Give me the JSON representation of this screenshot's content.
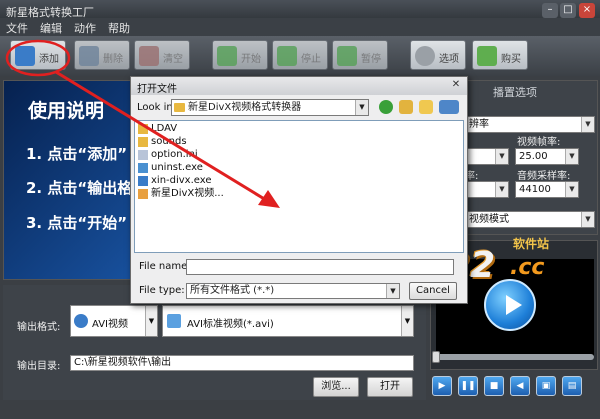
{
  "window": {
    "title": "新星格式转换工厂"
  },
  "menu": [
    "文件",
    "编辑",
    "动作",
    "帮助"
  ],
  "toolbar": {
    "add": "添加",
    "delete": "删除",
    "clear": "清空",
    "start": "开始",
    "stop": "停止",
    "pause": "暂停",
    "options": "选项",
    "buy": "购买"
  },
  "guide": {
    "title": "使用说明",
    "step1": "1. 点击“添加”",
    "step2": "2. 点击“输出格",
    "step3": "3. 点击“开始”"
  },
  "settings": {
    "title": "播置选项",
    "resolution_label": "辨率",
    "framerate_label": "视频帧率:",
    "framerate_value": "25.00",
    "samplerate_label": "音频采样率:",
    "samplerate_value": "44100",
    "channel_label": "率:",
    "mode_value": "视频模式"
  },
  "output": {
    "format_label": "输出格式:",
    "format_value": "AVI视频",
    "format_detail": "AVI标准视频(*.avi)",
    "dir_label": "输出目录:",
    "dir_value": "C:\\新星视频软件\\输出",
    "browse": "浏览...",
    "open": "打开"
  },
  "dialog": {
    "title": "打开文件",
    "look_in_label": "Look in:",
    "look_in_value": "新星DivX视频格式转换器",
    "files": [
      "LDAV",
      "sounds",
      "option.ini",
      "uninst.exe",
      "xin-divx.exe",
      "新星DivX视频..."
    ],
    "filename_label": "File name:",
    "filetype_label": "File type:",
    "filetype_value": "所有文件格式 (*.*)",
    "cancel": "Cancel"
  },
  "watermark": {
    "number": "3322",
    "tld": ".cc",
    "site": "软件站"
  },
  "colors": {
    "accent": "#1d5fb0",
    "annotation": "#e02020",
    "watermark": "#f39a1e"
  }
}
